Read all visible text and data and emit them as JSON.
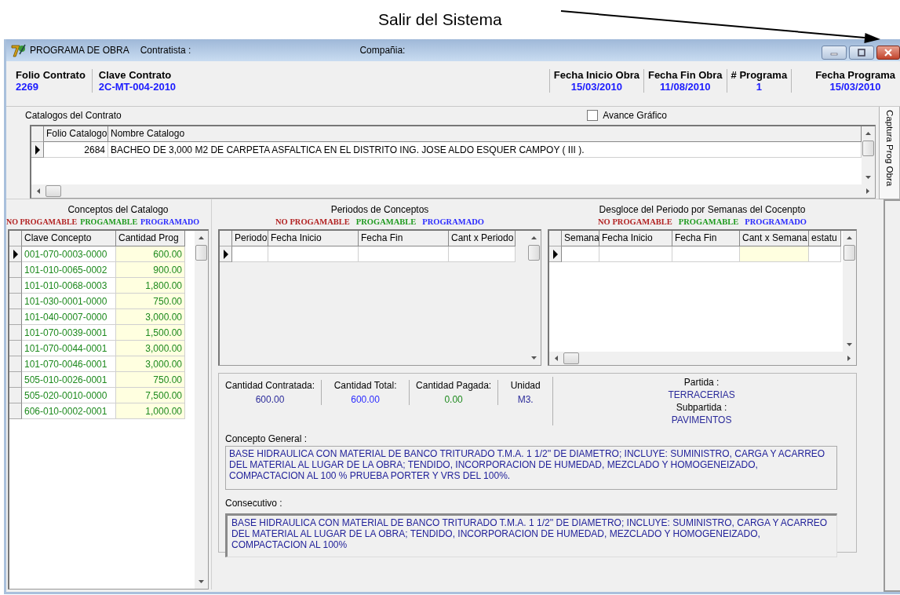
{
  "annotation": {
    "text": "Salir del Sistema"
  },
  "window": {
    "title": "PROGRAMA DE OBRA",
    "contratista_label": "Contratista :",
    "compania_label": "Compañia:"
  },
  "header": {
    "left_fields": [
      {
        "label": "Folio Contrato",
        "value": "2269"
      },
      {
        "label": "Clave Contrato",
        "value": "2C-MT-004-2010"
      }
    ],
    "right_fields": [
      {
        "label": "Fecha Inicio Obra",
        "value": "15/03/2010"
      },
      {
        "label": "Fecha Fin Obra",
        "value": "11/08/2010"
      },
      {
        "label": "# Programa",
        "value": "1"
      },
      {
        "label": "Fecha Programa",
        "value": "15/03/2010"
      }
    ]
  },
  "catalogos": {
    "title": "Catalogos del Contrato",
    "avance_grafico": {
      "label": "Avance Gráfico",
      "checked": false
    },
    "columns": [
      "Folio Catalogo",
      "Nombre Catalogo"
    ],
    "rows": [
      {
        "folio": "2684",
        "nombre": "BACHEO DE 3,000 M2 DE CARPETA ASFALTICA EN EL DISTRITO ING. JOSE ALDO ESQUER CAMPOY  ( III ).",
        "selected": true
      }
    ]
  },
  "side_tab": {
    "label": "Captura Prog Obra"
  },
  "conceptos": {
    "title": "Conceptos del Catalogo",
    "legend": [
      {
        "label": "NO PROGAMABLE",
        "color": "#b22222"
      },
      {
        "label": "PROGAMABLE",
        "color": "#1e9a1e"
      },
      {
        "label": "PROGRAMADO",
        "color": "#2b2bff"
      }
    ],
    "columns": [
      "Clave Concepto",
      "Cantidad Prog"
    ],
    "rows": [
      {
        "clave": "001-070-0003-0000",
        "cantidad": "600.00",
        "color": "#1e8a1e",
        "selected": true
      },
      {
        "clave": "101-010-0065-0002",
        "cantidad": "900.00",
        "color": "#1e8a1e",
        "selected": false
      },
      {
        "clave": "101-010-0068-0003",
        "cantidad": "1,800.00",
        "color": "#1e8a1e",
        "selected": false
      },
      {
        "clave": "101-030-0001-0000",
        "cantidad": "750.00",
        "color": "#1e8a1e",
        "selected": false
      },
      {
        "clave": "101-040-0007-0000",
        "cantidad": "3,000.00",
        "color": "#1e8a1e",
        "selected": false
      },
      {
        "clave": "101-070-0039-0001",
        "cantidad": "1,500.00",
        "color": "#1e8a1e",
        "selected": false
      },
      {
        "clave": "101-070-0044-0001",
        "cantidad": "3,000.00",
        "color": "#1e8a1e",
        "selected": false
      },
      {
        "clave": "101-070-0046-0001",
        "cantidad": "3,000.00",
        "color": "#1e8a1e",
        "selected": false
      },
      {
        "clave": "505-010-0026-0001",
        "cantidad": "750.00",
        "color": "#1e8a1e",
        "selected": false
      },
      {
        "clave": "505-020-0010-0000",
        "cantidad": "7,500.00",
        "color": "#1e8a1e",
        "selected": false
      },
      {
        "clave": "606-010-0002-0001",
        "cantidad": "1,000.00",
        "color": "#1e8a1e",
        "selected": false
      }
    ]
  },
  "periodos": {
    "title": "Periodos de Conceptos",
    "legend": [
      {
        "label": "NO PROGAMABLE",
        "color": "#b22222"
      },
      {
        "label": "PROGAMABLE",
        "color": "#1e9a1e"
      },
      {
        "label": "PROGRAMADO",
        "color": "#2b2bff"
      }
    ],
    "columns": [
      "Periodo",
      "Fecha Inicio",
      "Fecha Fin",
      "Cant x Periodo"
    ],
    "rows": [
      {
        "selected": true
      }
    ]
  },
  "desglose": {
    "title": "Desgloce del Periodo por Semanas del Cocenpto",
    "legend": [
      {
        "label": "NO PROGAMABLE",
        "color": "#b22222"
      },
      {
        "label": "PROGAMABLE",
        "color": "#1e9a1e"
      },
      {
        "label": "PROGRAMADO",
        "color": "#2b2bff"
      }
    ],
    "columns": [
      "Semana",
      "Fecha Inicio",
      "Fecha Fin",
      "Cant x Semana",
      "estatu"
    ],
    "rows": [
      {
        "selected": true
      }
    ]
  },
  "detalle": {
    "stats": [
      {
        "label": "Cantidad Contratada:",
        "value": "600.00",
        "color": "#2b2b9a"
      },
      {
        "label": "Cantidad Total:",
        "value": "600.00",
        "color": "#2b2bff"
      },
      {
        "label": "Cantidad Pagada:",
        "value": "0.00",
        "color": "#1e8a1e"
      },
      {
        "label": "Unidad",
        "value": "M3.",
        "color": "#2b2b9a"
      }
    ],
    "partida": {
      "label": "Partida :",
      "value": "TERRACERIAS"
    },
    "subpartida": {
      "label": "Subpartida :",
      "value": "PAVIMENTOS"
    },
    "concepto_general": {
      "label": "Concepto General :",
      "value": "BASE HIDRAULICA CON MATERIAL DE BANCO TRITURADO T.M.A.  1 1/2''  DE  DIAMETRO;  INCLUYE:  SUMINISTRO, CARGA Y ACARREO DEL MATERIAL AL LUGAR DE LA OBRA; TENDIDO,  INCORPORACION  DE  HUMEDAD,  MEZCLADO  Y HOMOGENEIZADO, COMPACTACION AL 100 % PRUEBA PORTER Y VRS DEL 100%."
    },
    "consecutivo": {
      "label": "Consecutivo :",
      "value": "BASE HIDRAULICA CON MATERIAL DE BANCO TRITURADO T.M.A.  1 1/2''  DE  DIAMETRO;  INCLUYE:  SUMINISTRO, CARGA Y ACARREO DEL MATERIAL AL LUGAR DE LA OBRA; TENDIDO,  INCORPORACION  DE  HUMEDAD,  MEZCLADO  Y HOMOGENEIZADO, COMPACTACION AL 100%"
    }
  }
}
